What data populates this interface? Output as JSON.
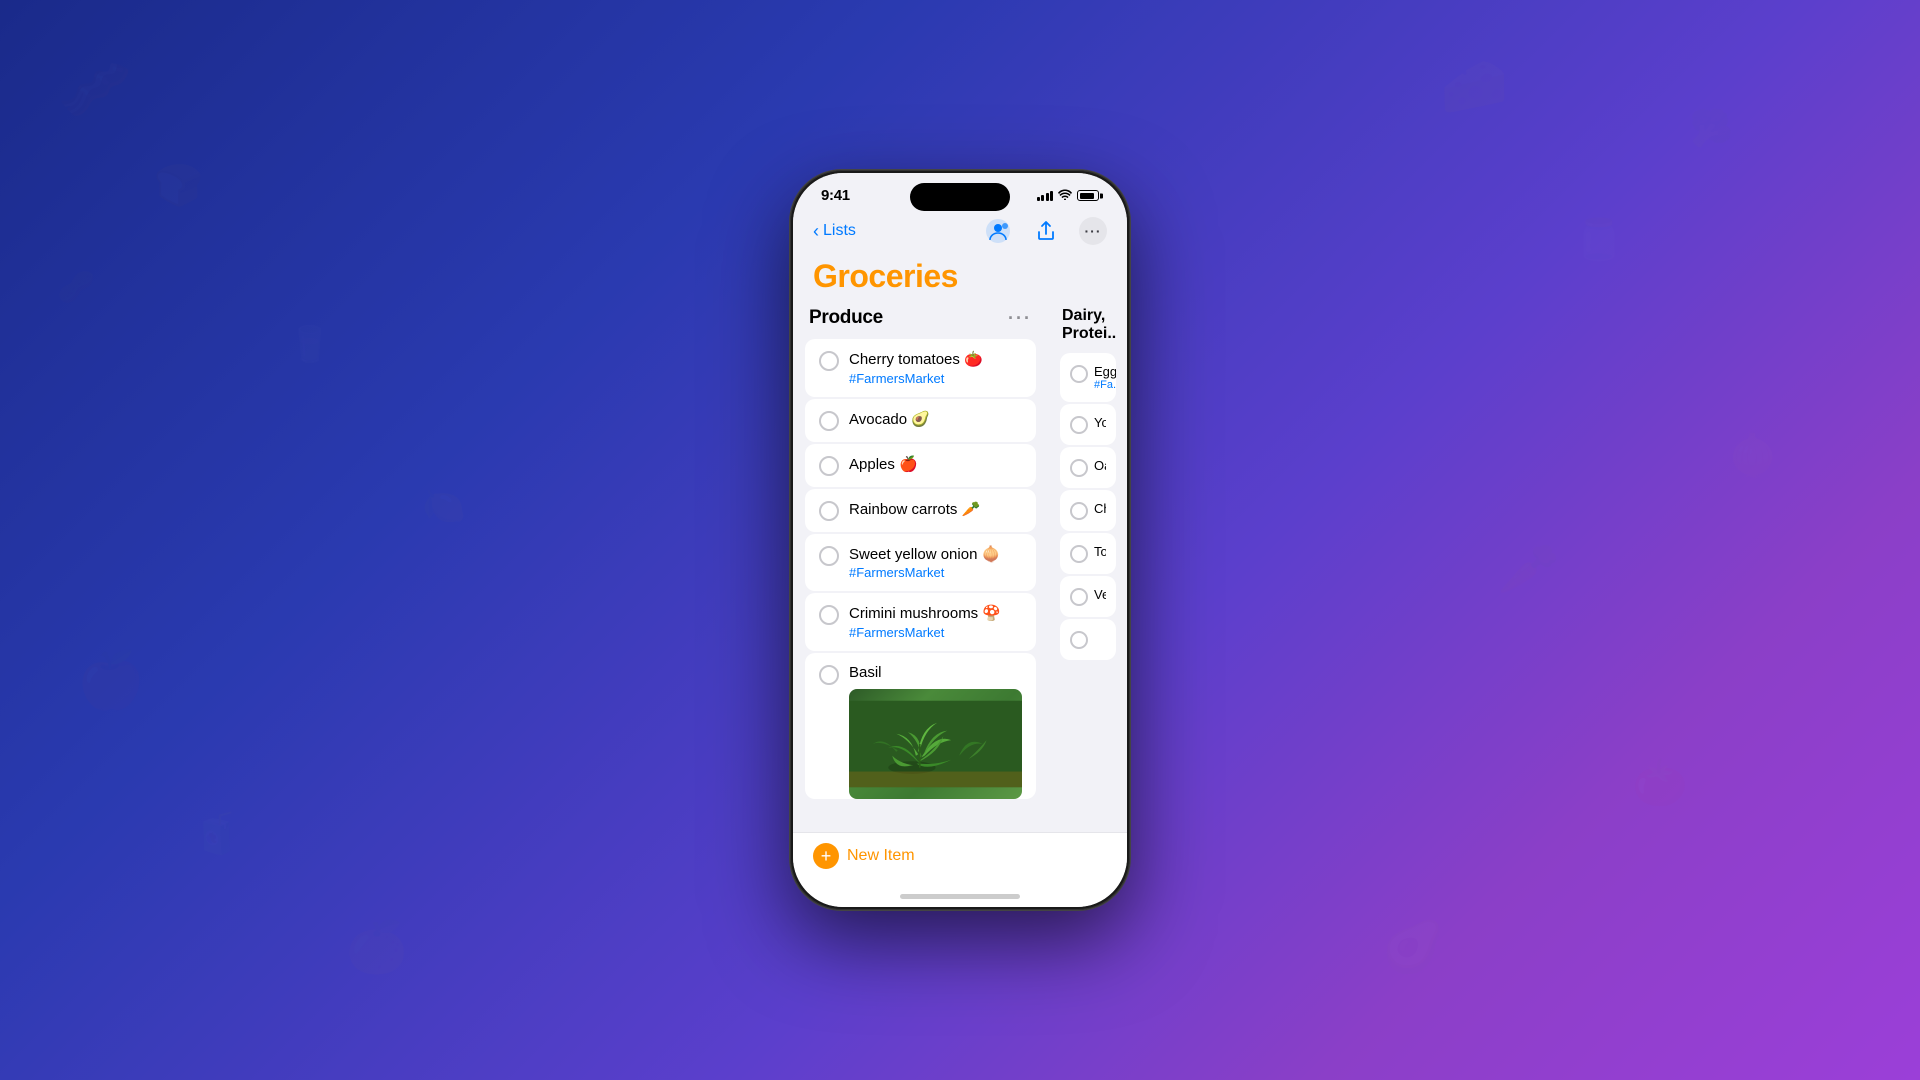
{
  "background": {
    "gradient": "linear-gradient(135deg, #1a2a8a, #5b3fcc, #8b3fc8)"
  },
  "phone": {
    "status_bar": {
      "time": "9:41",
      "signal": "••• ",
      "wifi": "wifi",
      "battery": "battery"
    },
    "nav": {
      "back_label": "Lists",
      "collaborate_icon": "collaborate",
      "share_icon": "share",
      "more_icon": "more"
    },
    "title": "Groceries",
    "produce_section": {
      "title": "Produce",
      "more_button": "...",
      "items": [
        {
          "id": 1,
          "text": "Cherry tomatoes 🍅",
          "tag": "#FarmersMarket",
          "checked": false
        },
        {
          "id": 2,
          "text": "Avocado 🥑",
          "tag": null,
          "checked": false
        },
        {
          "id": 3,
          "text": "Apples 🍎",
          "tag": null,
          "checked": false
        },
        {
          "id": 4,
          "text": "Rainbow carrots 🥕",
          "tag": null,
          "checked": false
        },
        {
          "id": 5,
          "text": "Sweet yellow onion 🧅",
          "tag": "#FarmersMarket",
          "checked": false
        },
        {
          "id": 6,
          "text": "Crimini mushrooms 🍄",
          "tag": "#FarmersMarket",
          "checked": false
        },
        {
          "id": 7,
          "text": "Basil",
          "tag": null,
          "checked": false,
          "has_image": true
        }
      ]
    },
    "dairy_section": {
      "title": "Dairy,",
      "title2": "Protei...",
      "items": [
        {
          "id": 1,
          "text": "Egg...",
          "tag": "#Fa...",
          "checked": false
        },
        {
          "id": 2,
          "text": "Yog...",
          "tag": null,
          "checked": false
        },
        {
          "id": 3,
          "text": "Oat...",
          "tag": null,
          "checked": false
        },
        {
          "id": 4,
          "text": "Che...",
          "tag": null,
          "checked": false
        },
        {
          "id": 5,
          "text": "Tof...",
          "tag": null,
          "checked": false
        },
        {
          "id": 6,
          "text": "Veg...",
          "tag": null,
          "checked": false
        },
        {
          "id": 7,
          "text": "",
          "tag": null,
          "checked": false
        }
      ]
    },
    "bottom_bar": {
      "new_item_label": "New Item",
      "new_item_icon": "+"
    }
  }
}
